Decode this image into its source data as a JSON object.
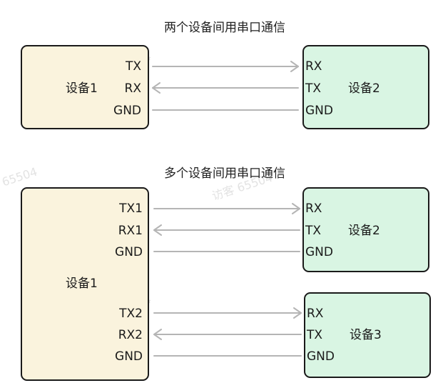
{
  "diagram1": {
    "title": "两个设备间用串口通信",
    "device_left": {
      "name": "设备1",
      "pins": [
        "TX",
        "RX",
        "GND"
      ]
    },
    "device_right": {
      "name": "设备2",
      "pins": [
        "RX",
        "TX",
        "GND"
      ]
    }
  },
  "diagram2": {
    "title": "多个设备间用串口通信",
    "device_main": {
      "name": "设备1",
      "pins_top": [
        "TX1",
        "RX1",
        "GND"
      ],
      "pins_bottom": [
        "TX2",
        "RX2",
        "GND"
      ]
    },
    "device_top": {
      "name": "设备2",
      "pins": [
        "RX",
        "TX",
        "GND"
      ]
    },
    "device_bottom": {
      "name": "设备3",
      "pins": [
        "RX",
        "TX",
        "GND"
      ]
    }
  },
  "watermark": "访客 65504",
  "watermark_fragment": "65504",
  "colors": {
    "device1_fill": "#faf3dd",
    "device_other_fill": "#d9f5e3",
    "wire": "#b5b5b5",
    "border": "#1a1a1a"
  }
}
